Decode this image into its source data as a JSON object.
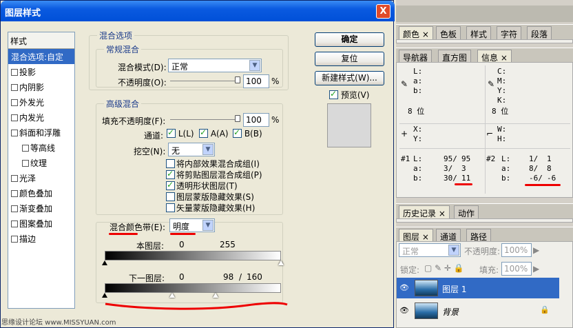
{
  "dialog": {
    "title": "图层样式",
    "close": "X"
  },
  "stylelist": {
    "header": "样式",
    "items": [
      {
        "label": "混合选项:自定",
        "checkbox": false,
        "selected": true
      },
      {
        "label": "投影",
        "checkbox": true
      },
      {
        "label": "内阴影",
        "checkbox": true
      },
      {
        "label": "外发光",
        "checkbox": true
      },
      {
        "label": "内发光",
        "checkbox": true
      },
      {
        "label": "斜面和浮雕",
        "checkbox": true
      },
      {
        "label": "等高线",
        "checkbox": true,
        "indent": true
      },
      {
        "label": "纹理",
        "checkbox": true,
        "indent": true
      },
      {
        "label": "光泽",
        "checkbox": true
      },
      {
        "label": "颜色叠加",
        "checkbox": true
      },
      {
        "label": "渐变叠加",
        "checkbox": true
      },
      {
        "label": "图案叠加",
        "checkbox": true
      },
      {
        "label": "描边",
        "checkbox": true
      }
    ]
  },
  "blend": {
    "section": "混合选项",
    "general": "常规混合",
    "mode_label": "混合模式(D):",
    "mode_value": "正常",
    "opacity_label": "不透明度(O):",
    "opacity_value": "100",
    "pct": "%"
  },
  "advanced": {
    "section": "高级混合",
    "fill_label": "填充不透明度(F):",
    "fill_value": "100",
    "pct": "%",
    "channels_label": "通道:",
    "ch_l": "L(L)",
    "ch_a": "A(A)",
    "ch_b": "B(B)",
    "knockout_label": "挖空(N):",
    "knockout_value": "无",
    "options": [
      {
        "label": "将内部效果混合成组(I)",
        "checked": false
      },
      {
        "label": "将剪贴图层混合成组(P)",
        "checked": true
      },
      {
        "label": "透明形状图层(T)",
        "checked": true
      },
      {
        "label": "图层蒙版隐藏效果(S)",
        "checked": false
      },
      {
        "label": "矢量蒙版隐藏效果(H)",
        "checked": false
      }
    ]
  },
  "blendif": {
    "label": "混合颜色带(E):",
    "value": "明度",
    "this_layer": "本图层:",
    "this_lo": "0",
    "this_hi": "255",
    "under_layer": "下一图层:",
    "under_lo": "0",
    "under_mid": "98",
    "under_sep": "/",
    "under_hi": "160",
    "under_knob_values": [
      0,
      98,
      160
    ]
  },
  "buttons": {
    "ok": "确定",
    "reset": "复位",
    "new_style": "新建样式(W)...",
    "preview": "预览(V)"
  },
  "panel_top": {
    "tabs": [
      "颜色",
      "色板",
      "样式",
      "字符",
      "段落"
    ]
  },
  "info": {
    "tabs": [
      "导航器",
      "直方图",
      "信息"
    ],
    "lab1": [
      "L:",
      "a:",
      "b:"
    ],
    "cmyk": [
      "C:",
      "M:",
      "Y:",
      "K:"
    ],
    "bit1": "8 位",
    "bit2": "8 位",
    "xy": [
      "X:",
      "Y:"
    ],
    "wh": [
      "W:",
      "H:"
    ],
    "s1": {
      "label": "#1",
      "rows": [
        [
          "L:",
          "95/",
          "95"
        ],
        [
          "a:",
          "3/",
          "3"
        ],
        [
          "b:",
          "30/",
          "11"
        ]
      ]
    },
    "s2": {
      "label": "#2",
      "rows": [
        [
          "L:",
          "1/",
          "1"
        ],
        [
          "a:",
          "8/",
          "8"
        ],
        [
          "b:",
          "-6/",
          "-6"
        ]
      ]
    }
  },
  "history": {
    "tabs": [
      "历史记录",
      "动作"
    ]
  },
  "layers": {
    "tabs": [
      "图层",
      "通道",
      "路径"
    ],
    "mode": "正常",
    "opacity_label": "不透明度:",
    "opacity": "100%",
    "lock_label": "锁定:",
    "fill_label": "填充:",
    "fill": "100%",
    "rows": [
      {
        "name": "图层 1",
        "selected": true
      },
      {
        "name": "背景",
        "selected": false
      }
    ]
  },
  "footer": "思缘设计论坛 www.MISSYUAN.com",
  "colors": {
    "accent": "#316ac5",
    "redmark": "#e00000"
  }
}
